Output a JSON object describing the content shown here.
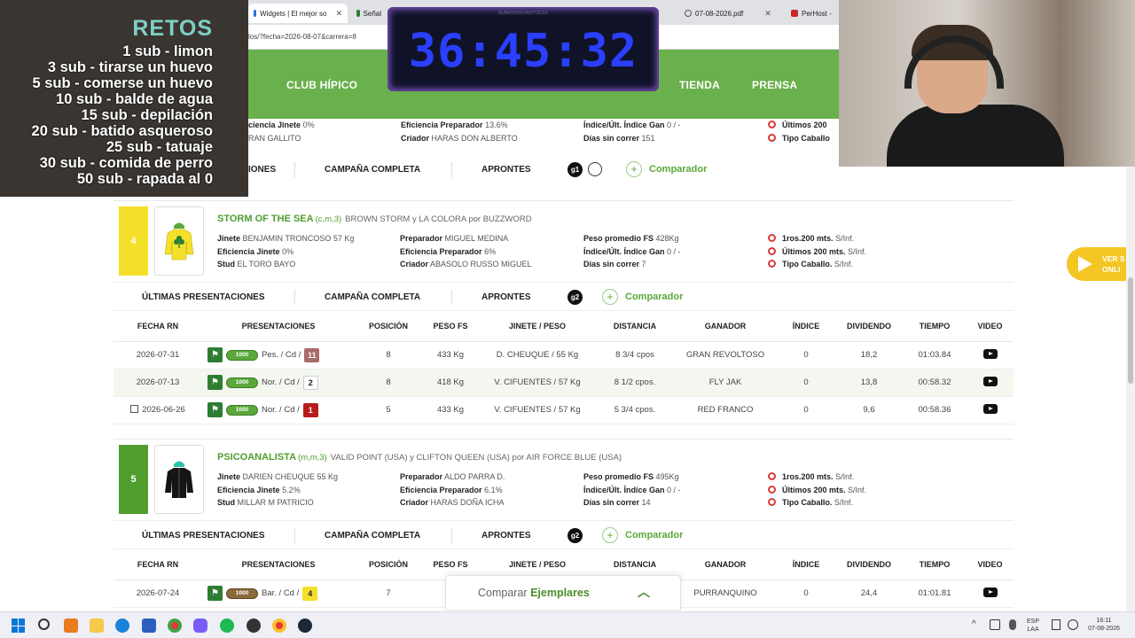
{
  "browser": {
    "tabs": [
      {
        "label": "Widgets | El mejor so"
      },
      {
        "label": "Señal"
      },
      {
        "label": "07-08-2026.pdf"
      },
      {
        "label": "PerHost -"
      }
    ],
    "url": "los/?fecha=2026-08-07&carrera=8"
  },
  "nav": {
    "items": [
      "CLUB HÍPICO",
      "TIENDA",
      "PRENSA"
    ]
  },
  "overlay": {
    "retos_title": "RETOS",
    "retos": [
      "1 sub - limon",
      "3 sub - tirarse un huevo",
      "5 sub - comerse un huevo",
      "10 sub - balde de agua",
      "15 sub - depilación",
      "20 sub - batido asqueroso",
      "25 sub - tatuaje",
      "30 sub - comida de perro",
      "50 sub - rapada al 0"
    ],
    "timer": "36:45:32",
    "timer_label": "SUBATHON PROTOCOL"
  },
  "prev": {
    "jinete_eff_label": "ciencia Jinete",
    "jinete_eff": "0%",
    "stud": "RAN GALLITO",
    "prep_eff_label": "Eficiencia Preparador",
    "prep_eff": "13.6%",
    "criador_label": "Criador",
    "criador": "HARAS DON ALBERTO",
    "indice_label": "Índice/Últ. Índice Gan",
    "indice": "0 / -",
    "dias_label": "Días sin correr",
    "dias": "151",
    "ult200_label": "Últimos 200",
    "tipo_label": "Tipo Caballo",
    "tab_a": "IONES",
    "tab_b": "CAMPAÑA COMPLETA",
    "tab_c": "APRONTES",
    "badge": "g1",
    "comp": "Comparador"
  },
  "horses": [
    {
      "number": "4",
      "name": "STORM OF THE SEA",
      "meta": "(c,m,3)",
      "pedigree": "BROWN STORM y LA COLORA por BUZZWORD",
      "jinete_label": "Jinete",
      "jinete": "BENJAMIN TRONCOSO 57 Kg",
      "eff_j_label": "Eficiencia Jinete",
      "eff_j": "0%",
      "stud_label": "Stud",
      "stud": "EL TORO BAYO",
      "prep_label": "Preparador",
      "prep": "MIGUEL MEDINA",
      "eff_p_label": "Eficiencia Preparador",
      "eff_p": "6%",
      "criador_label": "Criador",
      "criador": "ABASOLO RUSSO MIGUEL",
      "peso_label": "Peso promedio FS",
      "peso": "428Kg",
      "indice_label": "Índice/Últ. Índice Gan",
      "indice": "0 / -",
      "dias_label": "Días sin correr",
      "dias": "7",
      "r1_label": "1ros.200 mts.",
      "r1": "S/Inf.",
      "r2_label": "Últimos 200 mts.",
      "r2": "S/Inf.",
      "r3_label": "Tipo Caballo.",
      "r3": "S/Inf.",
      "tabs": [
        "ÚLTIMAS PRESENTACIONES",
        "CAMPAÑA COMPLETA",
        "APRONTES"
      ],
      "badge": "g2",
      "comp": "Comparador",
      "headers": [
        "FECHA RN",
        "PRESENTACIONES",
        "POSICIÓN",
        "PESO FS",
        "JINETE / PESO",
        "DISTANCIA",
        "GANADOR",
        "ÍNDICE",
        "DIVIDENDO",
        "TIEMPO",
        "VIDEO"
      ],
      "rows": [
        {
          "fecha": "2026-07-31",
          "dist": "1000",
          "pista": "Pes. / Cd /",
          "lugar": "11",
          "pos": "8",
          "peso": "433 Kg",
          "jinete": "D. CHEUQUE / 55 Kg",
          "distancia": "8 3/4 cpos",
          "ganador": "GRAN REVOLTOSO",
          "indice": "0",
          "dividendo": "18,2",
          "tiempo": "01:03.84"
        },
        {
          "fecha": "2026-07-13",
          "dist": "1000",
          "pista": "Nor. / Cd /",
          "lugar": "2",
          "pos": "8",
          "peso": "418 Kg",
          "jinete": "V. CIFUENTES / 57 Kg",
          "distancia": "8 1/2 cpos.",
          "ganador": "FLY JAK",
          "indice": "0",
          "dividendo": "13,8",
          "tiempo": "00:58.32"
        },
        {
          "fecha": "2026-06-26",
          "dist": "1000",
          "pista": "Nor. / Cd /",
          "lugar": "1",
          "pos": "5",
          "peso": "433 Kg",
          "jinete": "V. CIFUENTES / 57 Kg",
          "distancia": "5 3/4 cpos.",
          "ganador": "RED FRANCO",
          "indice": "0",
          "dividendo": "9,6",
          "tiempo": "00:58.36"
        }
      ]
    },
    {
      "number": "5",
      "name": "PSICOANALISTA",
      "meta": "(m,m,3)",
      "pedigree": "VALID POINT (USA) y CLIFTON QUEEN (USA) por AIR FORCE BLUE (USA)",
      "jinete_label": "Jinete",
      "jinete": "DARIEN CHEUQUE 55 Kg",
      "eff_j_label": "Eficiencia Jinete",
      "eff_j": "5.2%",
      "stud_label": "Stud",
      "stud": "MILLAR M PATRICIO",
      "prep_label": "Preparador",
      "prep": "ALDO PARRA D.",
      "eff_p_label": "Eficiencia Preparador",
      "eff_p": "6.1%",
      "criador_label": "Criador",
      "criador": "HARAS DOÑA ICHA",
      "peso_label": "Peso promedio FS",
      "peso": "495Kg",
      "indice_label": "Índice/Últ. Índice Gan",
      "indice": "0 / -",
      "dias_label": "Días sin correr",
      "dias": "14",
      "r1_label": "1ros.200 mts.",
      "r1": "S/Inf.",
      "r2_label": "Últimos 200 mts.",
      "r2": "S/Inf.",
      "r3_label": "Tipo Caballo.",
      "r3": "S/Inf.",
      "tabs": [
        "ÚLTIMAS PRESENTACIONES",
        "CAMPAÑA COMPLETA",
        "APRONTES"
      ],
      "badge": "g2",
      "comp": "Comparador",
      "headers": [
        "FECHA RN",
        "PRESENTACIONES",
        "POSICIÓN",
        "PESO FS",
        "JINETE / PESO",
        "DISTANCIA",
        "GANADOR",
        "ÍNDICE",
        "DIVIDENDO",
        "TIEMPO",
        "VIDEO"
      ],
      "rows": [
        {
          "fecha": "2026-07-24",
          "dist": "1000",
          "pista": "Bar. / Cd /",
          "lugar": "4",
          "pos": "7",
          "peso": "49",
          "jinete": "",
          "distancia": "",
          "ganador": "PURRANQUINO",
          "indice": "0",
          "dividendo": "24,4",
          "tiempo": "01:01.81"
        }
      ]
    }
  ],
  "compare": {
    "prefix": "Comparar",
    "strong": "Ejemplares"
  },
  "ver": {
    "line1": "VER S",
    "line2": "ONLI"
  },
  "taskbar": {
    "lang1": "ESP",
    "lang2": "LAA",
    "time": "16:11",
    "date": "07-08-2026"
  },
  "colors": {
    "green": "#6ab04c",
    "yellow": "#f4e02a",
    "horse5": "#4f9d2f"
  }
}
